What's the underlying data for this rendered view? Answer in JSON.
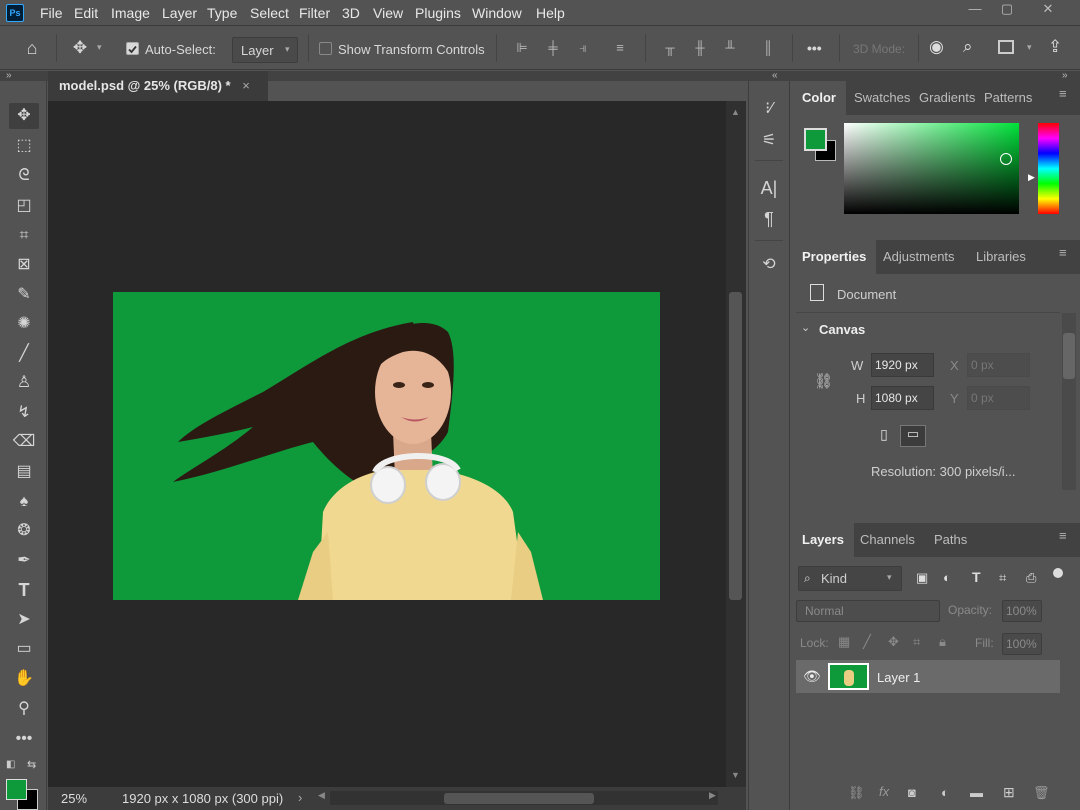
{
  "menu": {
    "logo": "Ps",
    "items": [
      "File",
      "Edit",
      "Image",
      "Layer",
      "Type",
      "Select",
      "Filter",
      "3D",
      "View",
      "Plugins",
      "Window",
      "Help"
    ]
  },
  "window_controls": {
    "minimize": "—",
    "restore": "▢",
    "close": "✕"
  },
  "options_bar": {
    "auto_select_label": "Auto-Select:",
    "auto_select_checked": true,
    "auto_select_target": "Layer",
    "show_transform_label": "Show Transform Controls",
    "show_transform_checked": false,
    "more": "•••",
    "mode_3d_label": "3D Mode:"
  },
  "document": {
    "tab_title": "model.psd @ 25% (RGB/8) *",
    "close": "×",
    "zoom": "25%",
    "status": "1920 px x 1080 px (300 ppi)",
    "canvas_color": "#0e9a3b"
  },
  "color_panel": {
    "tabs": [
      "Color",
      "Swatches",
      "Gradients",
      "Patterns"
    ],
    "foreground": "#0e9a3b",
    "background": "#000000",
    "hue_color": "#00e23a"
  },
  "properties_panel": {
    "tabs": [
      "Properties",
      "Adjustments",
      "Libraries"
    ],
    "type_label": "Document",
    "section_label": "Canvas",
    "w_label": "W",
    "w_value": "1920 px",
    "h_label": "H",
    "h_value": "1080 px",
    "x_label": "X",
    "x_value": "0 px",
    "y_label": "Y",
    "y_value": "0 px",
    "resolution": "Resolution: 300 pixels/i..."
  },
  "layers_panel": {
    "tabs": [
      "Layers",
      "Channels",
      "Paths"
    ],
    "filter_kind": "Kind",
    "blend_mode": "Normal",
    "opacity_label": "Opacity:",
    "opacity_value": "100%",
    "lock_label": "Lock:",
    "fill_label": "Fill:",
    "fill_value": "100%",
    "layers": [
      {
        "name": "Layer 1",
        "visible": true
      }
    ]
  },
  "colors": {
    "ui_bg": "#535353",
    "canvas_bg": "#282828",
    "accent_green": "#0e9a3b"
  }
}
